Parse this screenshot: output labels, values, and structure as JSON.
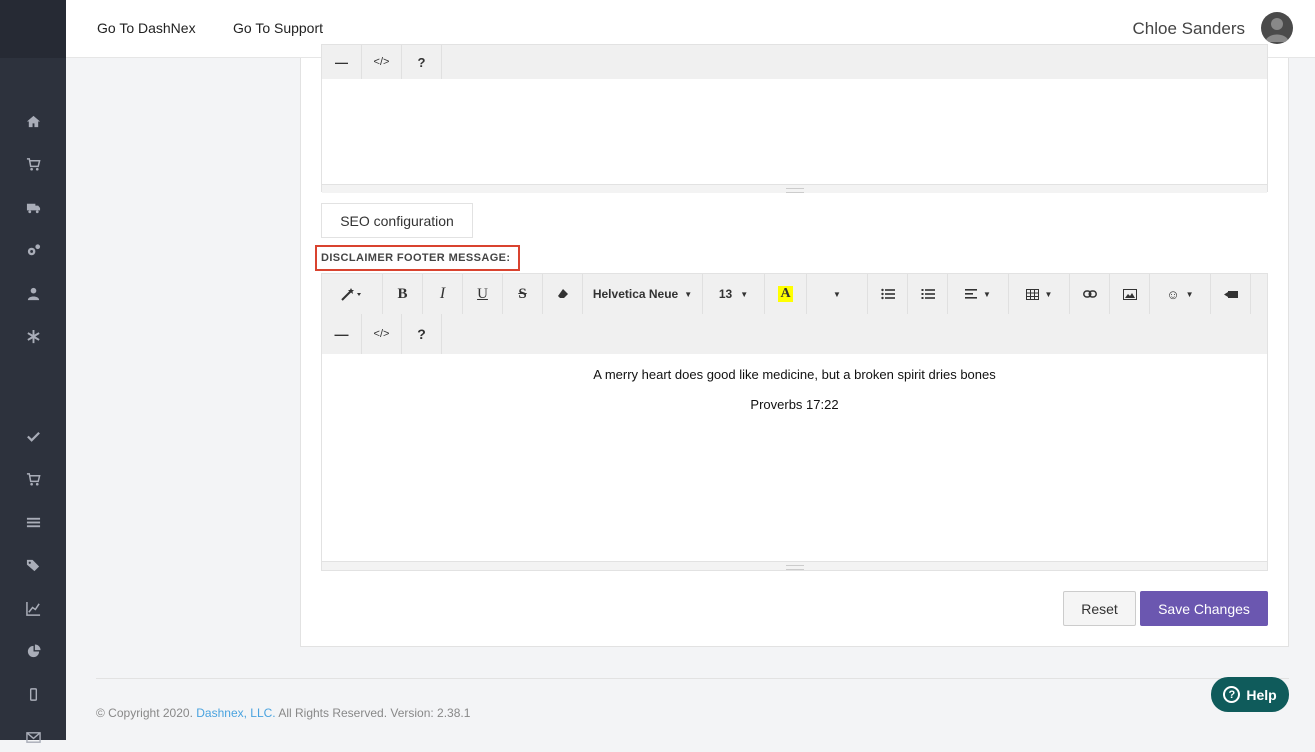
{
  "topbar": {
    "links": [
      "Go To DashNex",
      "Go To Support"
    ],
    "user_name": "Chloe Sanders"
  },
  "sidebar": {
    "icons": [
      "home-icon",
      "cart-icon",
      "truck-icon",
      "gears-icon",
      "user-icon",
      "asterisk-icon",
      "check-icon",
      "cart-icon",
      "list-icon",
      "tags-icon",
      "line-chart-icon",
      "pie-chart-icon",
      "mobile-icon",
      "envelope-icon"
    ]
  },
  "top_editor": {
    "toolbar_row2": [
      "—",
      "</>",
      "?"
    ]
  },
  "seo_tab": "SEO configuration",
  "disclaimer": {
    "label": "DISCLAIMER FOOTER MESSAGE:",
    "toolbar": {
      "font_name": "Helvetica Neue",
      "font_size": "13",
      "hr_symbol": "—",
      "code_symbol": "</>",
      "help_symbol": "?"
    },
    "content": [
      "A merry heart does good like medicine, but a broken spirit dries bones",
      "Proverbs 17:22"
    ]
  },
  "buttons": {
    "reset": "Reset",
    "save": "Save Changes"
  },
  "footer": {
    "prefix": "© Copyright 2020.",
    "brand": "Dashnex, LLC.",
    "suffix": "All Rights Reserved. Version: 2.38.1"
  },
  "help": {
    "label": "Help"
  },
  "colors": {
    "primary": "#6b57b0",
    "sidebar": "#2d323d",
    "highlight_box": "#d9432f",
    "help": "#0f5b5b",
    "link": "#4aa3df"
  }
}
